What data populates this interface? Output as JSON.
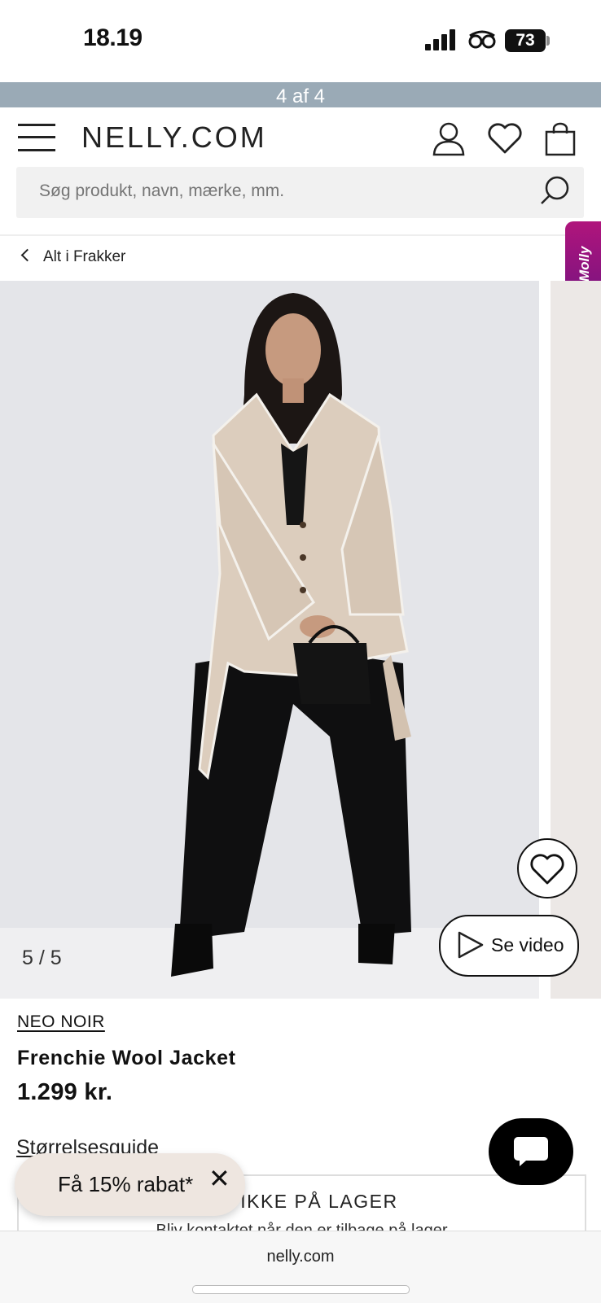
{
  "status_bar": {
    "time": "18.19",
    "battery": "73"
  },
  "promo_banner": {
    "text": "4 af 4"
  },
  "header": {
    "logo": "NELLY.COM"
  },
  "search": {
    "placeholder": "Søg produkt, navn, mærke, mm."
  },
  "breadcrumb": {
    "label": "Alt i Frakker"
  },
  "side_widget": {
    "label": "Molly"
  },
  "gallery": {
    "counter": "5 / 5",
    "video_label": "Se video"
  },
  "product": {
    "brand": "NEO NOIR",
    "name": "Frenchie Wool Jacket",
    "price": "1.299 kr.",
    "size_guide": "Størrelsesguide"
  },
  "stock": {
    "title": "ER IKKE PÅ LAGER",
    "subtitle": "Bliv kontaktet når den er tilbage på lager"
  },
  "discount_popup": {
    "label": "Få 15% rabat*"
  },
  "browser": {
    "url": "nelly.com"
  },
  "colors": {
    "banner": "#9aaab6",
    "molly": "#a0147d",
    "jacket": "#dccdbd"
  }
}
